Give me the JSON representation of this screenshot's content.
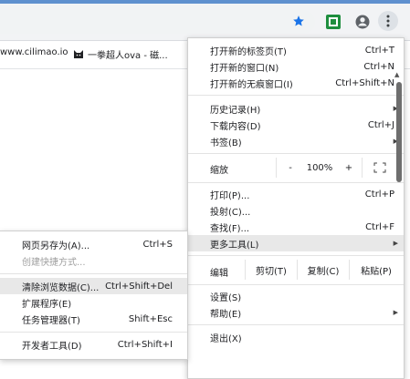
{
  "toolbar": {
    "bookmark_star_icon": "star-icon",
    "extension_icon": "extension-icon",
    "account_icon": "account-icon",
    "menu_icon": "three-dots-vertical-icon"
  },
  "bookmarks": {
    "items": [
      {
        "label": "www.cilimao.io"
      },
      {
        "label": "一拳超人ova - 磁..."
      }
    ]
  },
  "menu": {
    "new_tab": {
      "label": "打开新的标签页(T)",
      "shortcut": "Ctrl+T"
    },
    "new_window": {
      "label": "打开新的窗口(N)",
      "shortcut": "Ctrl+N"
    },
    "new_incognito": {
      "label": "打开新的无痕窗口(I)",
      "shortcut": "Ctrl+Shift+N"
    },
    "history": {
      "label": "历史记录(H)"
    },
    "downloads": {
      "label": "下载内容(D)",
      "shortcut": "Ctrl+J"
    },
    "bookmarks": {
      "label": "书签(B)"
    },
    "zoom": {
      "label": "缩放",
      "minus": "-",
      "value": "100%",
      "plus": "+",
      "fullscreen_icon": "fullscreen-icon"
    },
    "print": {
      "label": "打印(P)...",
      "shortcut": "Ctrl+P"
    },
    "cast": {
      "label": "投射(C)..."
    },
    "find": {
      "label": "查找(F)...",
      "shortcut": "Ctrl+F"
    },
    "more_tools": {
      "label": "更多工具(L)"
    },
    "edit": {
      "label": "编辑",
      "cut": "剪切(T)",
      "copy": "复制(C)",
      "paste": "粘贴(P)"
    },
    "settings": {
      "label": "设置(S)"
    },
    "help": {
      "label": "帮助(E)"
    },
    "exit": {
      "label": "退出(X)"
    }
  },
  "submenu": {
    "save_page": {
      "label": "网页另存为(A)...",
      "shortcut": "Ctrl+S"
    },
    "create_shortcut": {
      "label": "创建快捷方式..."
    },
    "clear_data": {
      "label": "清除浏览数据(C)...",
      "shortcut": "Ctrl+Shift+Del"
    },
    "extensions": {
      "label": "扩展程序(E)"
    },
    "task_manager": {
      "label": "任务管理器(T)",
      "shortcut": "Shift+Esc"
    },
    "devtools": {
      "label": "开发者工具(D)",
      "shortcut": "Ctrl+Shift+I"
    }
  },
  "colors": {
    "accent": "#1a73e8",
    "highlight": "#e8e8e8",
    "ext_green": "#1e8e3e"
  }
}
